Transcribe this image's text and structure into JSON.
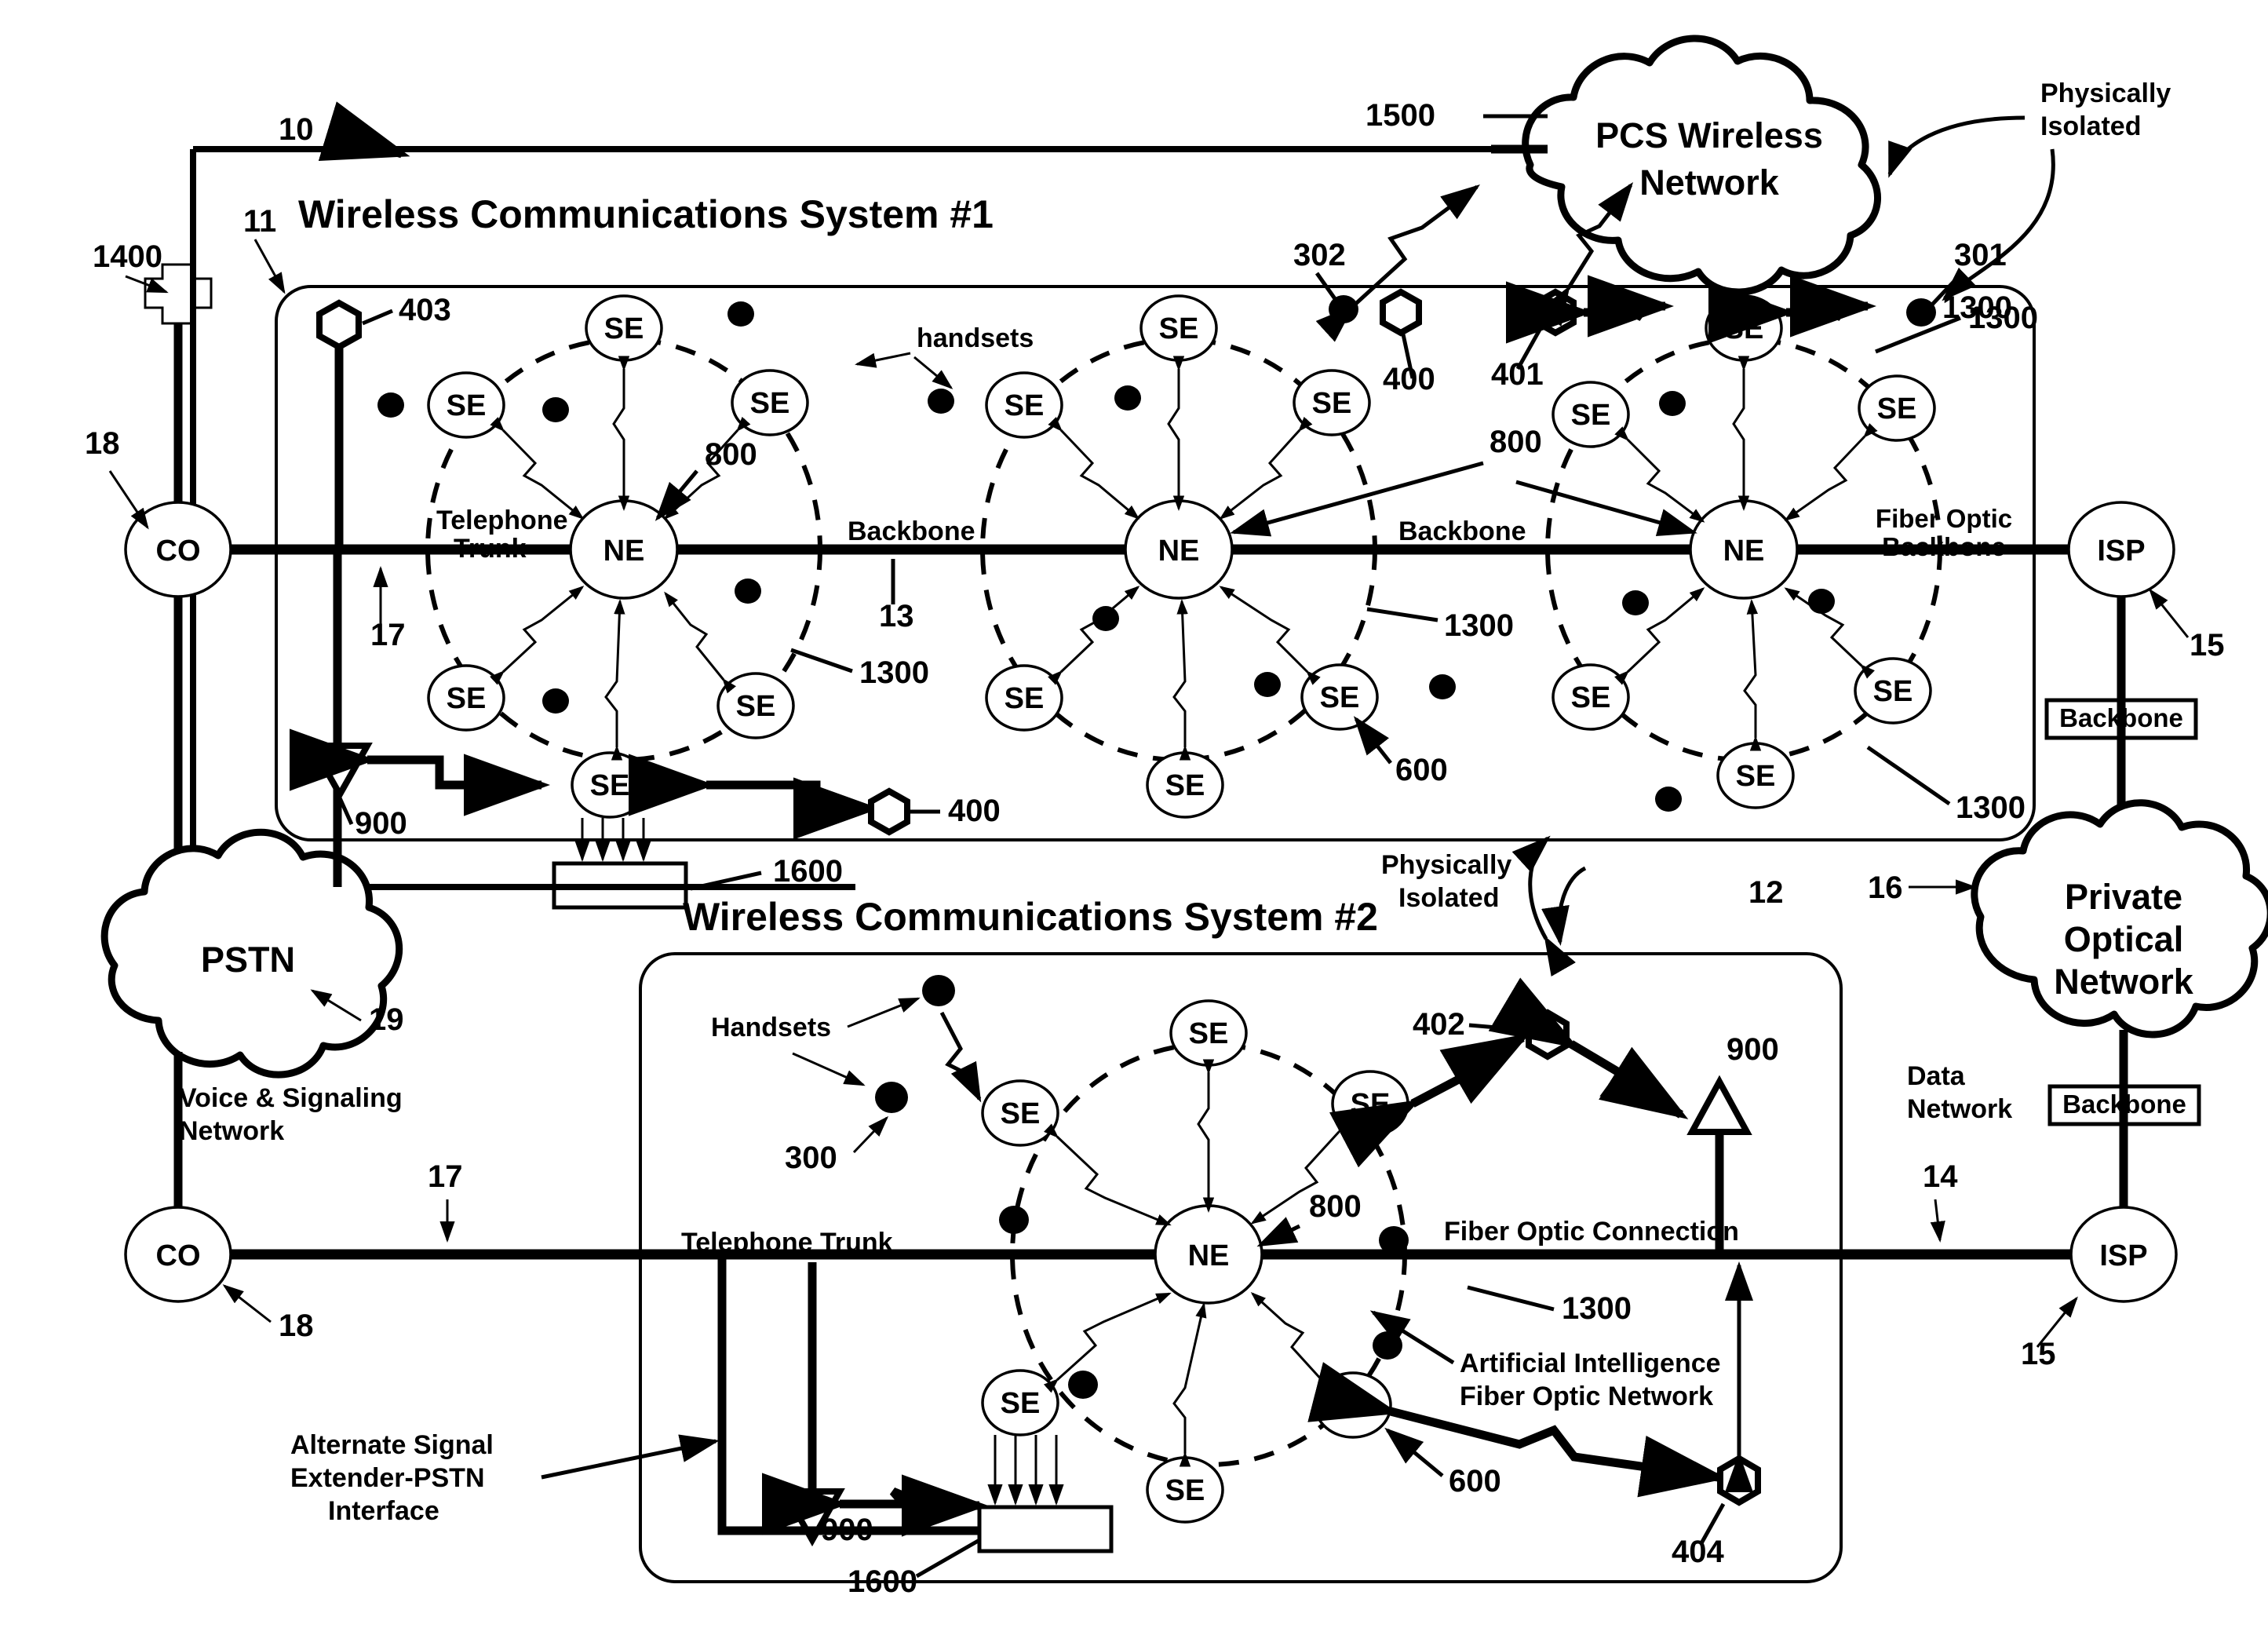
{
  "figure": {
    "kind": "patent-network-diagram",
    "overall_ref": "10"
  },
  "systems": [
    {
      "title": "Wireless Communications System #1",
      "ref": "11"
    },
    {
      "title": "Wireless Communications System #2",
      "ref": "12"
    }
  ],
  "clouds": {
    "pcs": {
      "line1": "PCS Wireless",
      "line2": "Network",
      "ref": "1500"
    },
    "pstn": {
      "label": "PSTN",
      "ref": "19"
    },
    "private": {
      "line1": "Private",
      "line2": "Optical",
      "line3": "Network",
      "ref": "16"
    }
  },
  "nodes": {
    "se": "SE",
    "ne": "NE",
    "co": "CO",
    "isp": "ISP"
  },
  "labels": {
    "handsets_lower": "handsets",
    "handsets_upper": "Handsets",
    "telephone_trunk": "Telephone\nTrunk",
    "telephone_trunk_1": "Telephone",
    "telephone_trunk_2": "Trunk",
    "telephone_trunk_sys2": "Telephone Trunk",
    "backbone": "Backbone",
    "backbone_box": "Backbone",
    "fiber_optic_backbone_1": "Fiber Optic",
    "fiber_optic_backbone_2": "Backbone",
    "fiber_optic_connection": "Fiber Optic Connection",
    "physically_isolated_1": "Physically",
    "physically_isolated_2": "Isolated",
    "voice_signaling_1": "Voice & Signaling",
    "voice_signaling_2": "Network",
    "data_network_1": "Data",
    "data_network_2": "Network",
    "ai_fiber_1": "Artificial Intelligence",
    "ai_fiber_2": "Fiber Optic Network",
    "alt_iface_1": "Alternate Signal",
    "alt_iface_2": "Extender-PSTN",
    "alt_iface_3": "Interface"
  },
  "refs": {
    "r10": "10",
    "r11": "11",
    "r12": "12",
    "r13": "13",
    "r14": "14",
    "r15": "15",
    "r16": "16",
    "r17": "17",
    "r18": "18",
    "r19": "19",
    "r300": "300",
    "r301": "301",
    "r302": "302",
    "r400": "400",
    "r401": "401",
    "r402": "402",
    "r403": "403",
    "r404": "404",
    "r600": "600",
    "r800": "800",
    "r900": "900",
    "r1300": "1300",
    "r1400": "1400",
    "r1500": "1500",
    "r1600": "1600"
  },
  "colors": {
    "ink": "#000000",
    "paper": "#ffffff"
  }
}
